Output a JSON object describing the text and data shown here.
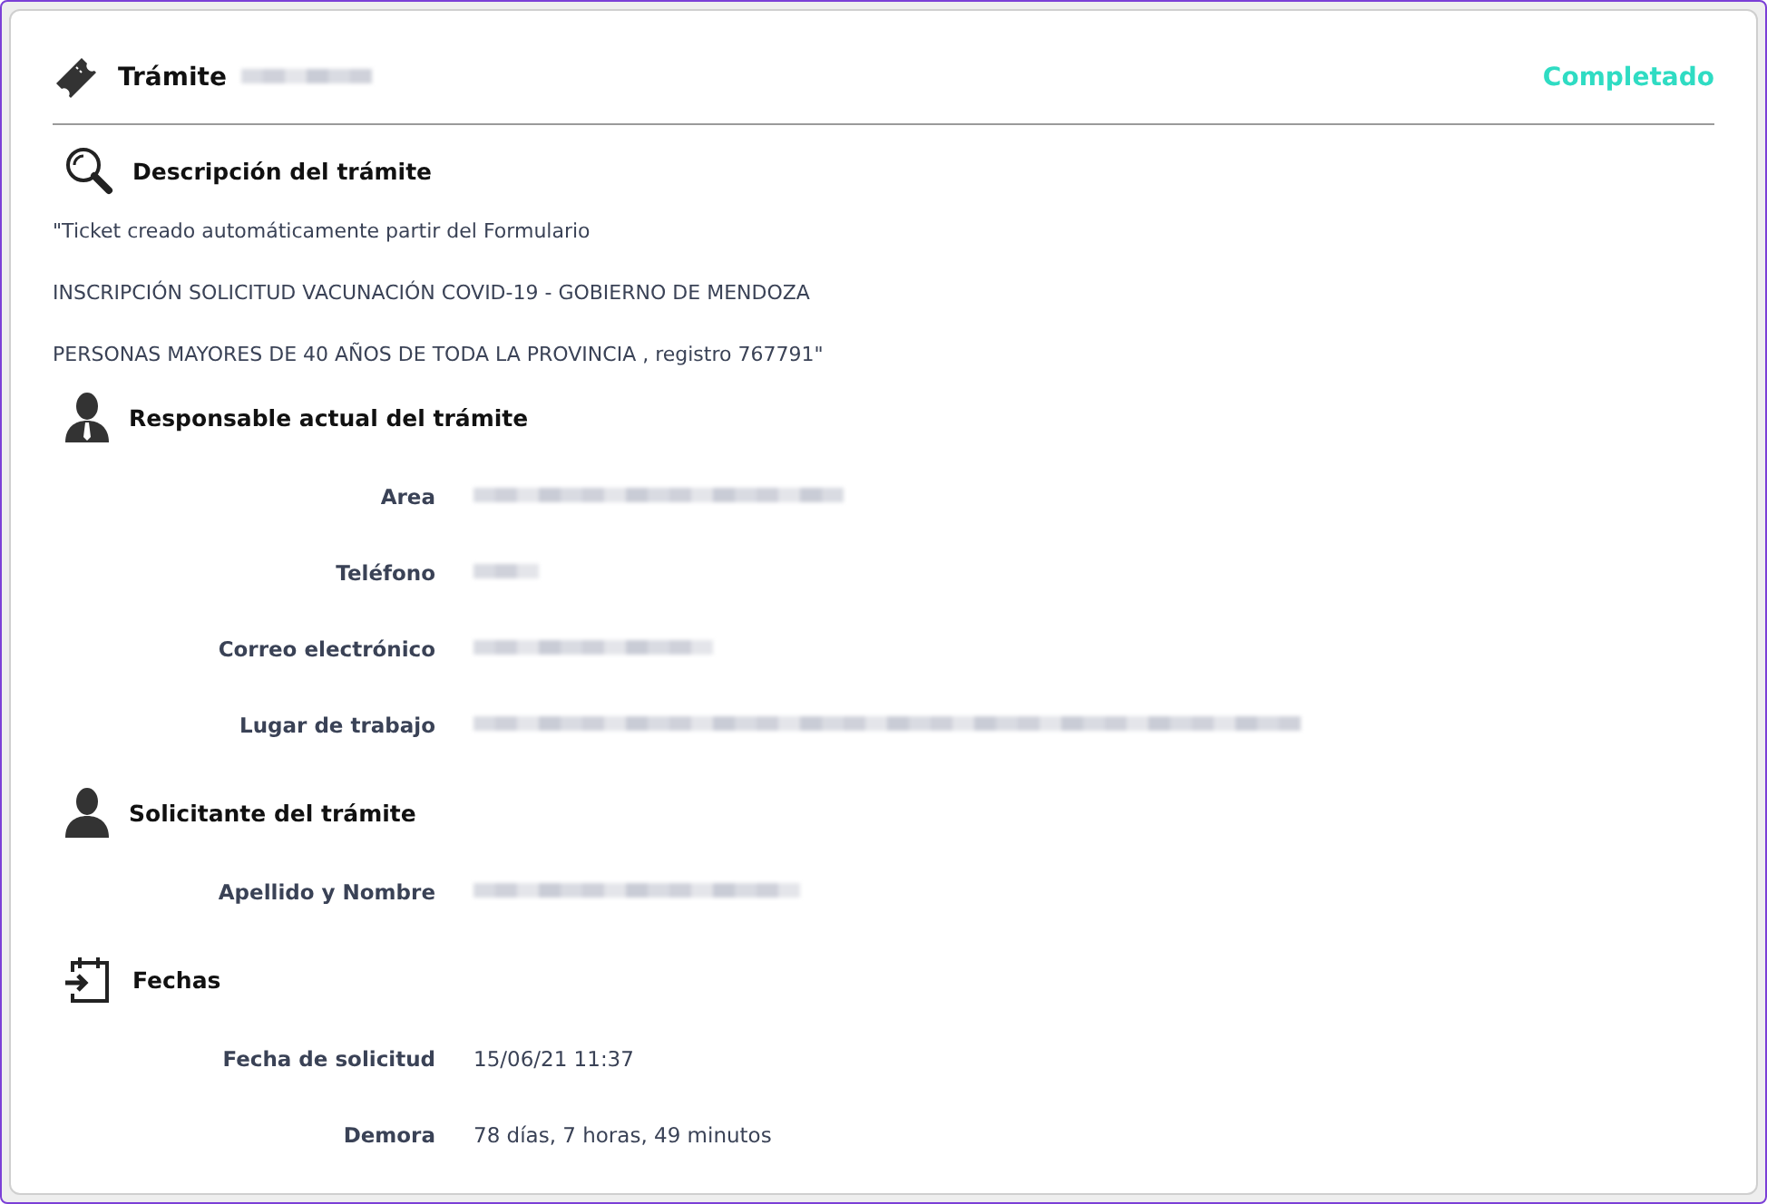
{
  "header": {
    "title": "Trámite",
    "title_redacted": true,
    "status": "Completado"
  },
  "sections": [
    {
      "kind": "description",
      "heading": "Descripción del trámite",
      "paragraphs": [
        "\"Ticket creado automáticamente partir del Formulario",
        "INSCRIPCIÓN SOLICITUD VACUNACIÓN COVID-19 - GOBIERNO DE MENDOZA",
        "PERSONAS MAYORES DE 40 AÑOS DE TODA LA PROVINCIA , registro 767791\""
      ]
    },
    {
      "kind": "fields",
      "heading": "Responsable actual del trámite",
      "fields": [
        {
          "label": "Area",
          "redacted": true
        },
        {
          "label": "Teléfono",
          "redacted": true
        },
        {
          "label": "Correo electrónico",
          "redacted": true
        },
        {
          "label": "Lugar de trabajo",
          "redacted": true
        }
      ]
    },
    {
      "kind": "fields",
      "heading": "Solicitante del trámite",
      "fields": [
        {
          "label": "Apellido y Nombre",
          "redacted": true
        }
      ]
    },
    {
      "kind": "fields",
      "heading": "Fechas",
      "fields": [
        {
          "label": "Fecha de solicitud",
          "value": "15/06/21 11:37",
          "redacted": false
        },
        {
          "label": "Demora",
          "value": "78 días, 7 horas, 49 minutos",
          "redacted": false
        }
      ]
    }
  ]
}
